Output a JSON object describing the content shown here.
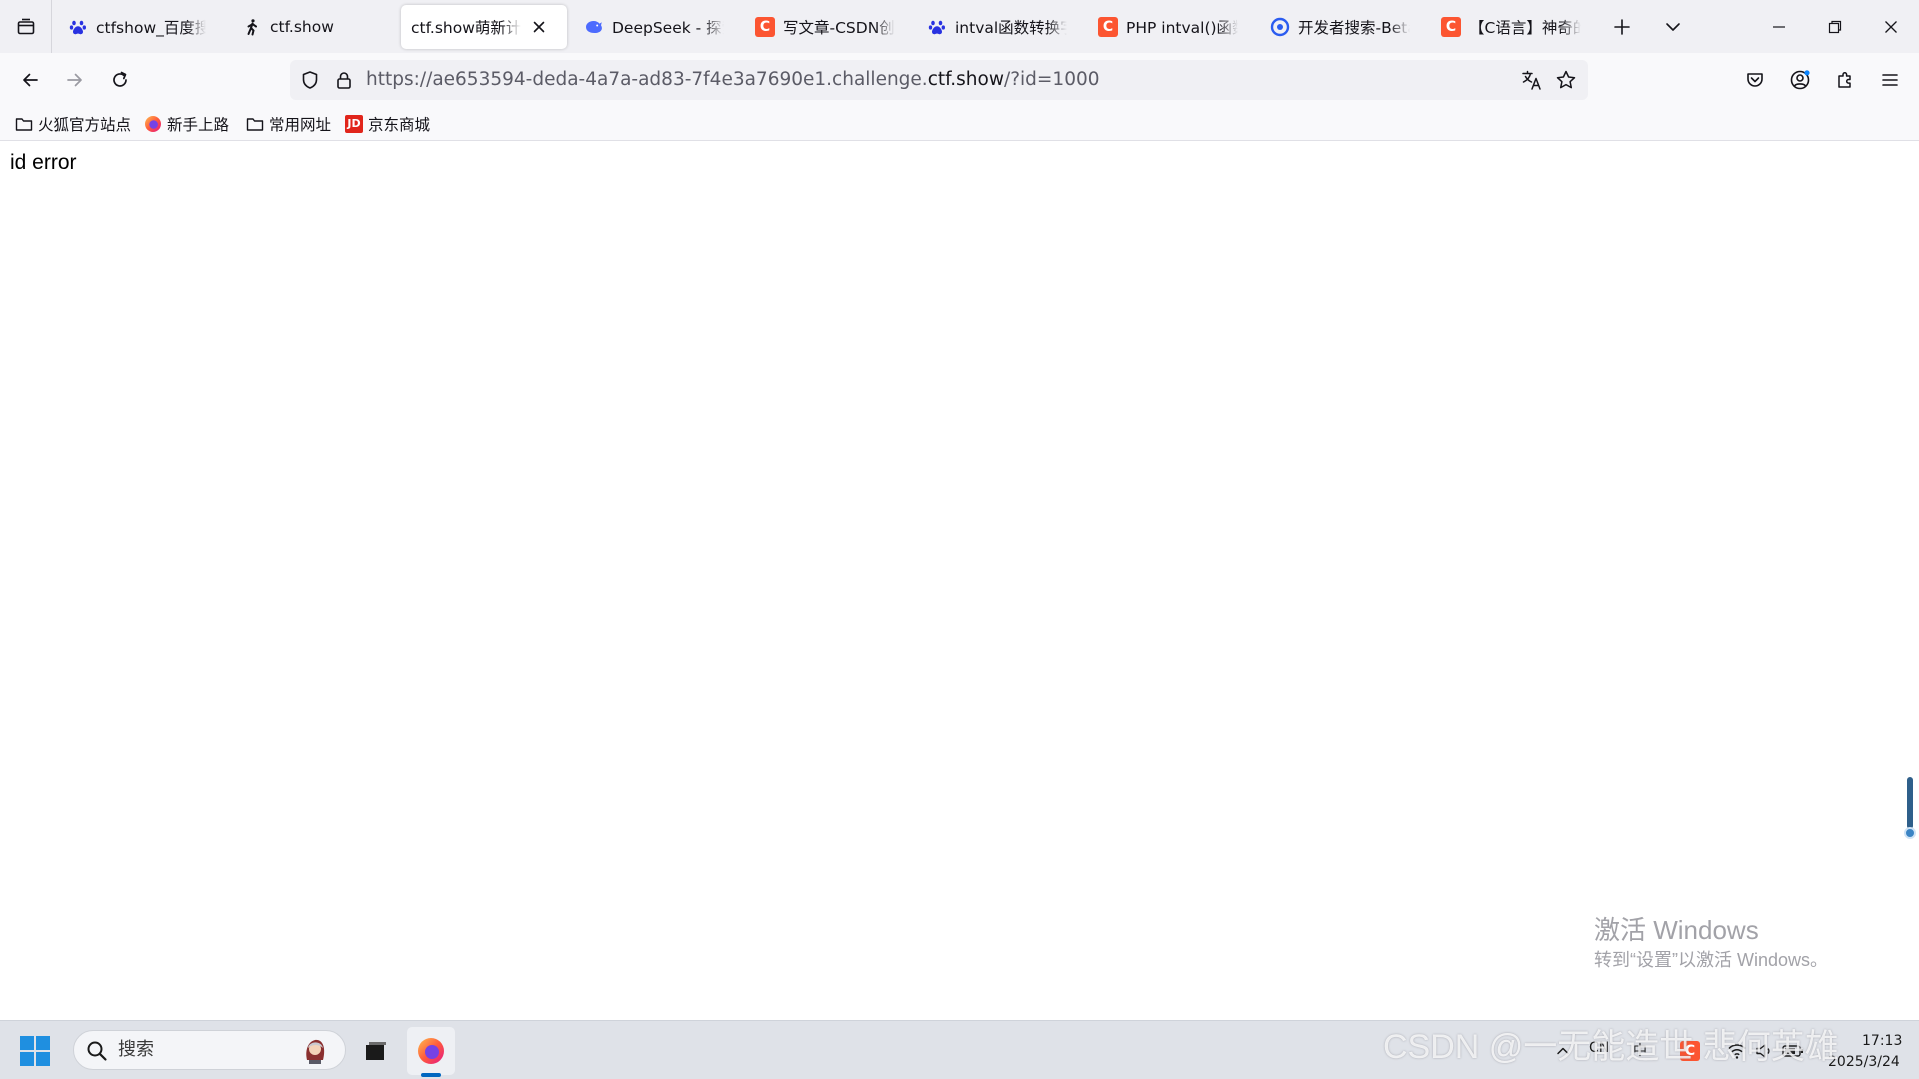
{
  "browser": {
    "tabs": [
      {
        "title": "ctfshow_百度搜索",
        "favicon": "baidu-paw-icon",
        "active": false
      },
      {
        "title": "ctf.show",
        "favicon": "ctfshow-runner-icon",
        "active": false
      },
      {
        "title": "ctf.show萌新计划web",
        "favicon": "",
        "active": true
      },
      {
        "title": "DeepSeek - 探索未至之境",
        "favicon": "deepseek-whale-icon",
        "active": false
      },
      {
        "title": "写文章-CSDN创作中心",
        "favicon": "csdn-c-icon",
        "active": false
      },
      {
        "title": "intval函数转换字符串",
        "favicon": "baidu-paw-icon",
        "active": false
      },
      {
        "title": "PHP intval()函数详解",
        "favicon": "csdn-c-icon",
        "active": false
      },
      {
        "title": "开发者搜索-Beta",
        "favicon": "dev-search-icon",
        "active": false
      },
      {
        "title": "【C语言】神奇的函数",
        "favicon": "csdn-c-icon",
        "active": false
      }
    ],
    "csdn_letter": "C",
    "url": {
      "prefix": "https://ae653594-deda-4a7a-ad83-7f4e3a7690e1.challenge.",
      "domain": "ctf.show",
      "suffix": "/?id=1000"
    },
    "bookmarks": [
      {
        "label": "火狐官方站点",
        "icon": "folder-icon"
      },
      {
        "label": "新手上路",
        "icon": "firefox-icon"
      },
      {
        "label": "常用网址",
        "icon": "folder-icon"
      },
      {
        "label": "京东商城",
        "icon": "jd-icon"
      }
    ],
    "jd_letters": "JD"
  },
  "page": {
    "body_text": "id error"
  },
  "overlay": {
    "activate_title": "激活 Windows",
    "activate_sub": "转到“设置”以激活 Windows。",
    "watermark": "CSDN @一无能造世 悲何英雄"
  },
  "taskbar": {
    "search_placeholder": "搜索",
    "tray_ime_1": "CN",
    "tray_ime_2": "中",
    "time": "17:13",
    "date": "2025/3/24"
  },
  "colors": {
    "accent": "#0067c0",
    "csdn": "#fc5531",
    "windows_blue": "#1f8fe0"
  }
}
